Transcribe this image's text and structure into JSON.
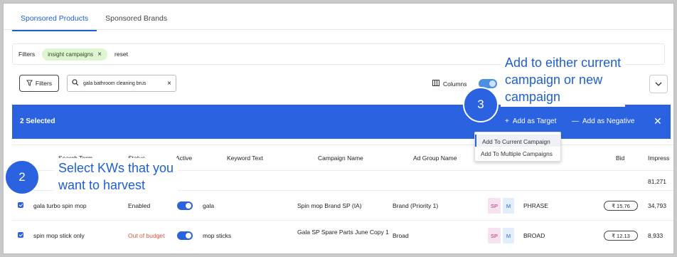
{
  "tabs": [
    {
      "label": "Sponsored Products"
    },
    {
      "label": "Sponsored Brands"
    }
  ],
  "filters_bar": {
    "label": "Filters",
    "chip": "insight campaigns",
    "reset": "reset"
  },
  "toolbar": {
    "filters_button": "Filters",
    "search_value": "gala bathroom cleaning brus",
    "columns_label": "Columns"
  },
  "selection_bar": {
    "selected_text": "2 Selected",
    "add_target": "Add as Target",
    "add_negative": "Add as Negative"
  },
  "menu": {
    "items": [
      "Add To Current Campaign",
      "Add To Multiple Campaigns"
    ]
  },
  "table": {
    "headers": [
      "Search Term",
      "Status",
      "Active",
      "Keyword Text",
      "Campaign Name",
      "Ad Group Name",
      "Bid",
      "Impress"
    ],
    "total_impressions": "81,271",
    "rows": [
      {
        "search_term": "gala turbo spin mop",
        "status": "Enabled",
        "keyword": "gala",
        "campaign": "Spin mop Brand SP (IA)",
        "ad_group": "Brand (Priority 1)",
        "tag1": "SP",
        "tag2": "M",
        "match": "PHRASE",
        "bid": "₹ 15.76",
        "impressions": "34,793"
      },
      {
        "search_term": "spin mop stick only",
        "status": "Out of budget",
        "keyword": "mop sticks",
        "campaign": "Gala SP Spare Parts June Copy 1",
        "ad_group": "Broad",
        "tag1": "SP",
        "tag2": "M",
        "match": "BROAD",
        "bid": "₹ 12.13",
        "impressions": "8,933"
      }
    ]
  },
  "annotations": {
    "step2": "2",
    "step2_text_line1": "Select KWs that you",
    "step2_text_line2": "want to harvest",
    "step3": "3",
    "step3_text_line1": "Add to either current",
    "step3_text_line2": "campaign or new",
    "step3_text_line3": "campaign"
  },
  "colors": {
    "accent": "#2a62e0",
    "chip_bg": "#dff5d2",
    "out_of_budget": "#e5533c"
  }
}
